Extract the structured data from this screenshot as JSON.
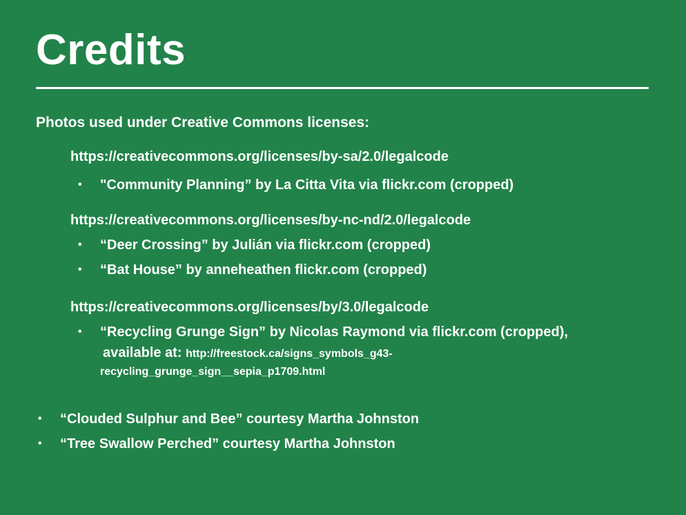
{
  "slide": {
    "title": "Credits",
    "heading": "Photos used under Creative Commons licenses:",
    "licenses": [
      {
        "url": "https://creativecommons.org/licenses/by-sa/2.0/legalcode",
        "items": [
          "\"Community Planning” by La Citta Vita via flickr.com (cropped)"
        ]
      },
      {
        "url": "https://creativecommons.org/licenses/by-nc-nd/2.0/legalcode",
        "items": [
          "“Deer Crossing” by Julián via flickr.com (cropped)",
          "“Bat House” by anneheathen flickr.com (cropped)"
        ]
      },
      {
        "url": "https://creativecommons.org/licenses/by/3.0/legalcode",
        "item": {
          "line1": "“Recycling Grunge Sign” by Nicolas Raymond via flickr.com (cropped),",
          "available_label": "available at:",
          "link_part1": "http://freestock.ca/signs_symbols_g43-",
          "link_part2": "recycling_grunge_sign__sepia_p1709.html"
        }
      }
    ],
    "courtesy": [
      "“Clouded Sulphur and Bee” courtesy Martha Johnston",
      "“Tree Swallow Perched” courtesy Martha Johnston"
    ],
    "bullet_glyph": "•",
    "colors": {
      "background": "#22834a",
      "text": "#ffffff"
    }
  }
}
